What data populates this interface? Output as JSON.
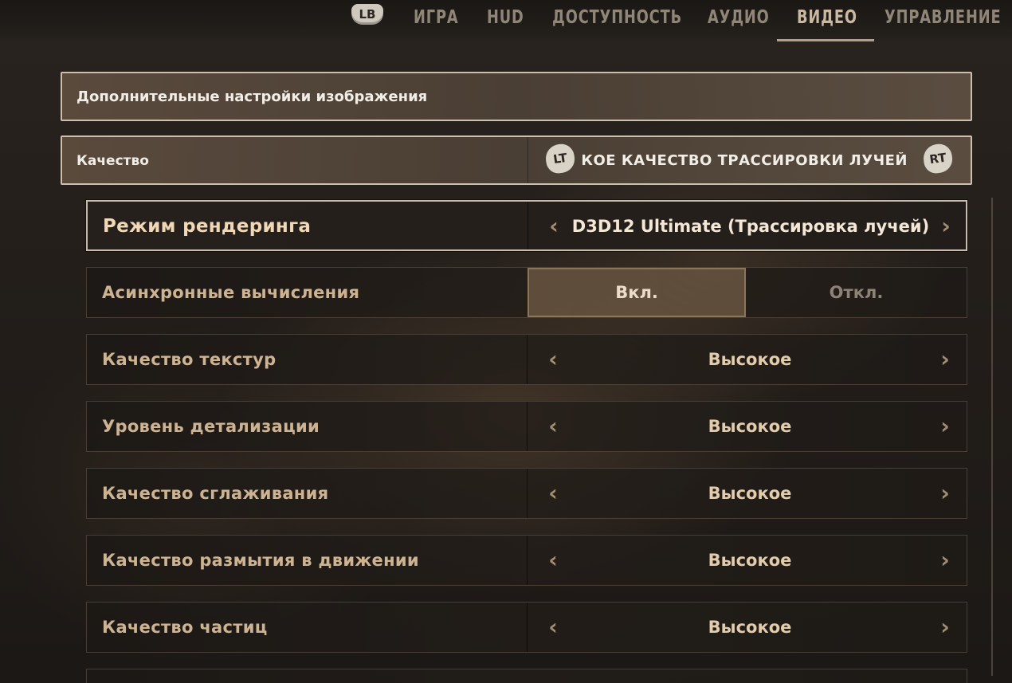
{
  "nav": {
    "lb_label": "LB",
    "tabs": [
      {
        "label": "ИГРА",
        "active": false
      },
      {
        "label": "HUD",
        "active": false
      },
      {
        "label": "ДОСТУПНОСТЬ",
        "active": false
      },
      {
        "label": "АУДИО",
        "active": false
      },
      {
        "label": "ВИДЕО",
        "active": true
      },
      {
        "label": "УПРАВЛЕНИЕ",
        "active": false
      }
    ]
  },
  "section": {
    "title": "Дополнительные настройки изображения"
  },
  "quality": {
    "label": "Качество",
    "lt_label": "LT",
    "rt_label": "RT",
    "value": "ВЫСОКОЕ КАЧЕСТВО ТРАССИРОВКИ ЛУЧЕЙ"
  },
  "settings": [
    {
      "label": "Режим рендеринга",
      "value": "D3D12 Ultimate (Трассировка лучей)",
      "selected": true
    },
    {
      "label": "Асинхронные вычисления",
      "toggle_on": "Вкл.",
      "toggle_off": "Откл.",
      "state": "on"
    },
    {
      "label": "Качество текстур",
      "value": "Высокое"
    },
    {
      "label": "Уровень детализации",
      "value": "Высокое"
    },
    {
      "label": "Качество сглаживания",
      "value": "Высокое"
    },
    {
      "label": "Качество размытия в движении",
      "value": "Высокое"
    },
    {
      "label": "Качество частиц",
      "value": "Высокое"
    }
  ],
  "colors": {
    "label_text": "#cdb391",
    "value_text": "#e3ccab",
    "header_border": "#cbbfae",
    "toggle_active_bg": "#76604a"
  }
}
